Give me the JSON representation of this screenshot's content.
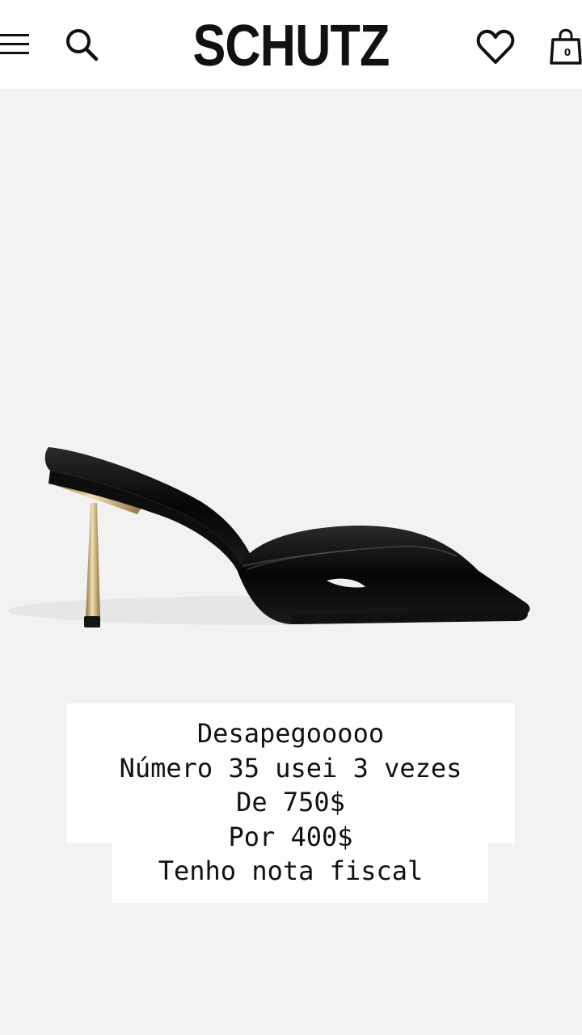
{
  "header": {
    "brand": "SCHUTZ",
    "cart_count": "0",
    "icons": {
      "menu": "menu-icon",
      "search": "search-icon",
      "wishlist": "heart-icon",
      "cart": "shopping-bag-icon"
    }
  },
  "product": {
    "image": "black-patent-peep-toe-mule-with-gold-stiletto-heel"
  },
  "caption": {
    "lines": [
      "Desapegooooo",
      "Número 35 usei 3 vezes",
      "De 750$",
      "Por 400$",
      "Tenho nota fiscal"
    ]
  },
  "colors": {
    "header_background": "#ffffff",
    "page_background": "#f2f2f2",
    "text": "#111111",
    "heel_gold": "#c9a86a"
  }
}
